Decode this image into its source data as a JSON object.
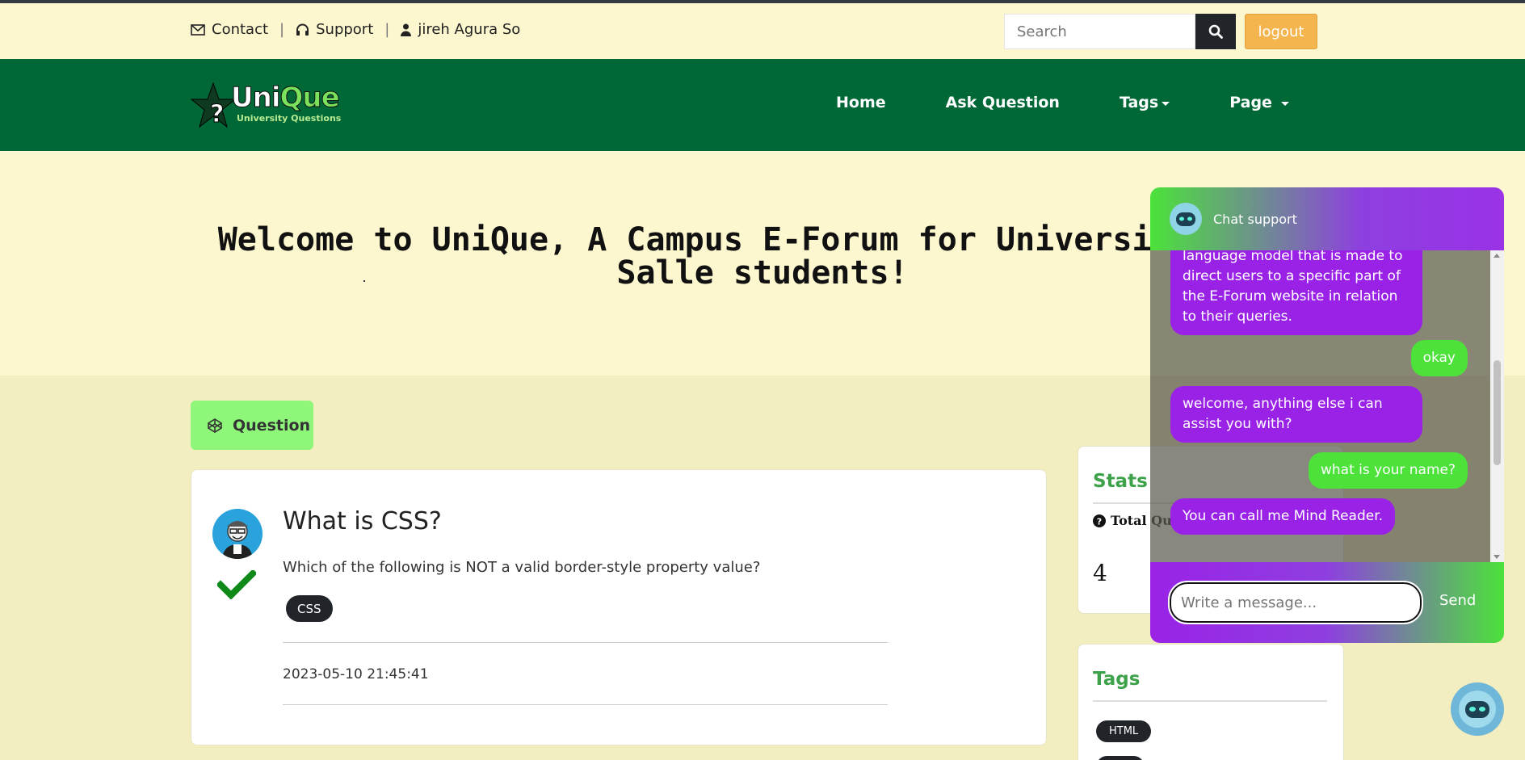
{
  "topbar": {
    "contact": "Contact",
    "support": "Support",
    "user": "jireh Agura So",
    "search_placeholder": "Search",
    "logout": "logout"
  },
  "logo": {
    "word_a": "Uni",
    "word_b": "Que",
    "subtitle": "University Questions"
  },
  "nav": {
    "home": "Home",
    "ask": "Ask Question",
    "tags": "Tags",
    "page": "Page"
  },
  "hero": {
    "title": "Welcome to UniQue, A Campus E-Forum for University of La Salle students!"
  },
  "question_tab": {
    "label": "Question"
  },
  "question": {
    "title": "What is CSS?",
    "description": "Which of the following is NOT a valid border-style property value?",
    "tag": "CSS",
    "date": "2023-05-10 21:45:41"
  },
  "stats": {
    "title": "Stats",
    "total_label": "Total Questions",
    "total_value": "4"
  },
  "tags_panel": {
    "title": "Tags",
    "tag1": "HTML"
  },
  "chat": {
    "header": "Chat support",
    "messages": [
      {
        "from": "bot",
        "text": "language model that is made to direct users to a specific part of the E-Forum website in relation to their queries."
      },
      {
        "from": "user",
        "text": "okay"
      },
      {
        "from": "bot",
        "text": "welcome, anything else i can assist you with?"
      },
      {
        "from": "user",
        "text": "what is your name?"
      },
      {
        "from": "bot",
        "text": "You can call me Mind Reader."
      }
    ],
    "input_placeholder": "Write a message...",
    "send": "Send"
  },
  "colors": {
    "nav_green": "#006837",
    "accent_green": "#8ef77a",
    "chat_purple": "#9a22e6",
    "chat_green": "#4ce23a",
    "logout": "#f4b44e"
  }
}
